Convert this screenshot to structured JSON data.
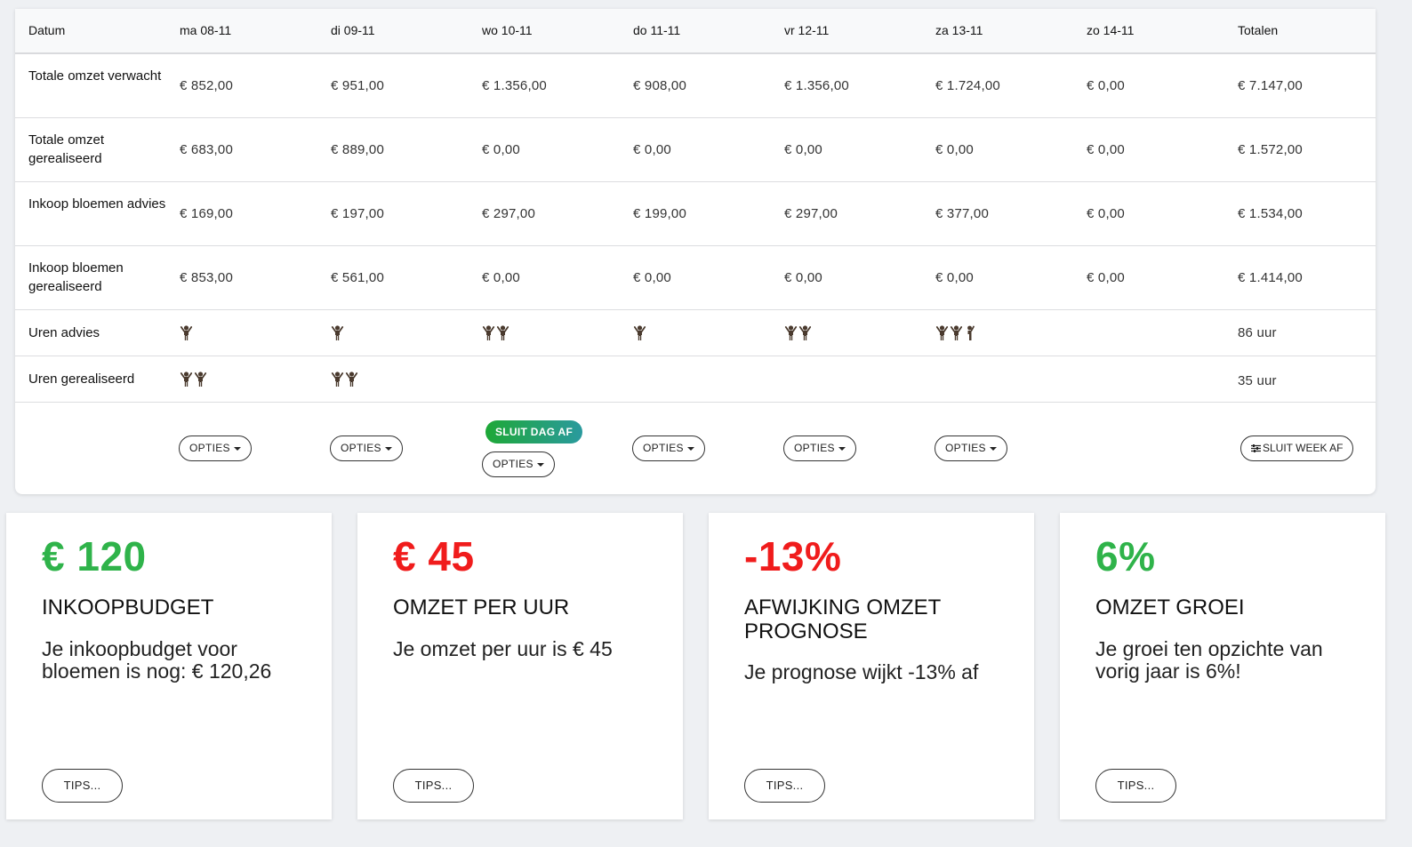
{
  "table": {
    "columns": [
      "Datum",
      "ma 08-11",
      "di 09-11",
      "wo 10-11",
      "do 11-11",
      "vr 12-11",
      "za 13-11",
      "zo 14-11",
      "Totalen"
    ],
    "rows": [
      {
        "label": "Totale omzet verwacht",
        "values": [
          "€ 852,00",
          "€ 951,00",
          "€ 1.356,00",
          "€ 908,00",
          "€ 1.356,00",
          "€ 1.724,00",
          "€ 0,00",
          "€ 7.147,00"
        ]
      },
      {
        "label": "Totale omzet gerealiseerd",
        "values": [
          "€ 683,00",
          "€ 889,00",
          "€ 0,00",
          "€ 0,00",
          "€ 0,00",
          "€ 0,00",
          "€ 0,00",
          "€ 1.572,00"
        ]
      },
      {
        "label": "Inkoop bloemen advies",
        "values": [
          "€ 169,00",
          "€ 197,00",
          "€ 297,00",
          "€ 199,00",
          "€ 297,00",
          "€ 377,00",
          "€ 0,00",
          "€ 1.534,00"
        ]
      },
      {
        "label": "Inkoop bloemen gerealiseerd",
        "values": [
          "€ 853,00",
          "€ 561,00",
          "€ 0,00",
          "€ 0,00",
          "€ 0,00",
          "€ 0,00",
          "€ 0,00",
          "€ 1.414,00"
        ]
      }
    ],
    "hours": [
      {
        "label": "Uren advies",
        "people": [
          1,
          1,
          2,
          1,
          2,
          2.5,
          0
        ],
        "total": "86 uur"
      },
      {
        "label": "Uren gerealiseerd",
        "people": [
          2,
          2,
          0,
          0,
          0,
          0,
          0
        ],
        "total": "35 uur"
      }
    ],
    "person_icon": "person-icon",
    "person_color": "#4a3a2e",
    "actions": {
      "opties_label": "OPTIES",
      "sluit_dag_label": "SLUIT DAG AF",
      "sluit_week_label": "SLUIT WEEK AF",
      "sluit_dag_column": 2,
      "opties_columns": [
        0,
        1,
        2,
        3,
        4,
        5
      ]
    }
  },
  "kpis": [
    {
      "value": "€ 120",
      "value_color": "#2fb34a",
      "title": "INKOOPBUDGET",
      "text": "Je inkoopbudget voor bloemen is nog: € 120,26",
      "button": "TIPS..."
    },
    {
      "value": "€ 45",
      "value_color": "#f01c1c",
      "title": "OMZET PER UUR",
      "text": "Je omzet per uur is € 45",
      "button": "TIPS..."
    },
    {
      "value": "-13%",
      "value_color": "#f01c1c",
      "title": "AFWIJKING OMZET PROGNOSE",
      "text": "Je prognose wijkt -13% af",
      "button": "TIPS..."
    },
    {
      "value": "6%",
      "value_color": "#2fb34a",
      "title": "OMZET GROEI",
      "text": "Je groei ten opzichte van vorig jaar is 6%!",
      "button": "TIPS..."
    }
  ]
}
